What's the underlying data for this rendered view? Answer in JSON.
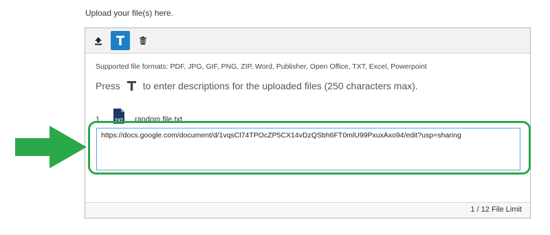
{
  "intro_text": "Upload your file(s) here.",
  "toolbar": {
    "upload_icon": "upload-icon",
    "description_icon": "text-t-icon",
    "delete_icon": "trash-icon",
    "active_color": "#1f7ec8"
  },
  "formats_text": "Supported file formats: PDF, JPG, GIF, PNG, ZIP, Word, Publisher, Open Office, TXT, Excel, Powerpoint",
  "hint": {
    "before": "Press",
    "after": "to enter descriptions for the uploaded files (250 characters max)."
  },
  "files": [
    {
      "number": "1.",
      "type_label": "TXT",
      "name": "random file.txt",
      "description": "https://docs.google.com/document/d/1vqsCl74TPOcZP5CX14vDzQSbh6FT0mlU99PxuxAxo94/edit?usp=sharing"
    }
  ],
  "file_limit": "1 / 12 File Limit",
  "annotation": {
    "arrow_color": "#2aa84a",
    "highlight_color": "#2aa84a"
  }
}
